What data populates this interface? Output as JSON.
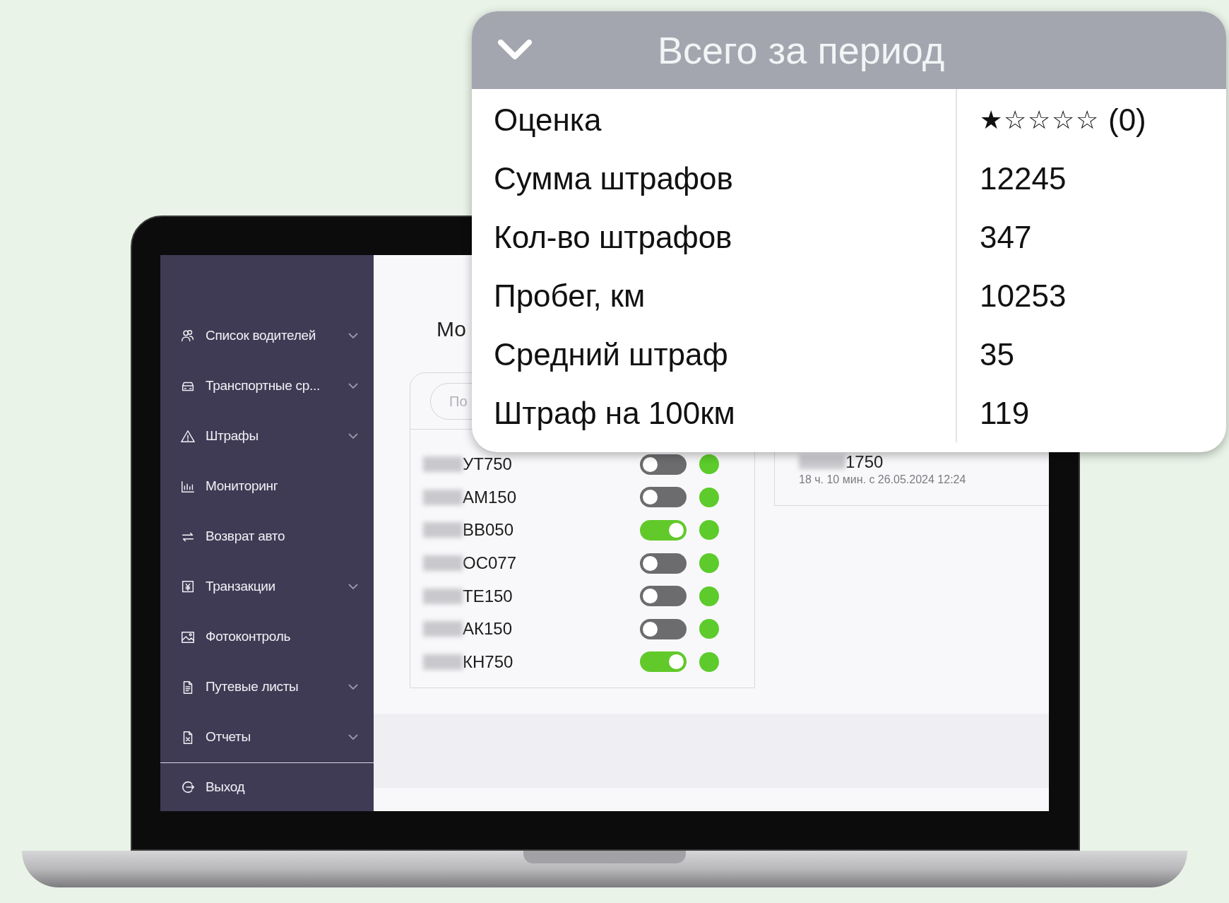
{
  "sidebar": {
    "items": [
      {
        "label": "Список водителей",
        "expandable": true
      },
      {
        "label": "Транспортные ср...",
        "expandable": true
      },
      {
        "label": "Штрафы",
        "expandable": true
      },
      {
        "label": "Мониторинг",
        "expandable": false
      },
      {
        "label": "Возврат авто",
        "expandable": false
      },
      {
        "label": "Транзакции",
        "expandable": true
      },
      {
        "label": "Фотоконтроль",
        "expandable": false
      },
      {
        "label": "Путевые листы",
        "expandable": true
      },
      {
        "label": "Отчеты",
        "expandable": true
      }
    ],
    "exit": {
      "label": "Выход"
    }
  },
  "page_title": "Мо",
  "search": {
    "placeholder": "По"
  },
  "vehicles": [
    {
      "plate": "УТ750",
      "on": false,
      "color": "#5ccb2b"
    },
    {
      "plate": "АМ150",
      "on": false,
      "color": "#5ccb2b"
    },
    {
      "plate": "ВВ050",
      "on": true,
      "color": "#5ccb2b"
    },
    {
      "plate": "ОС077",
      "on": false,
      "color": "#5ccb2b"
    },
    {
      "plate": "ТЕ150",
      "on": false,
      "color": "#5ccb2b"
    },
    {
      "plate": "АК150",
      "on": false,
      "color": "#5ccb2b"
    },
    {
      "plate": "КН750",
      "on": true,
      "color": "#5ccb2b"
    }
  ],
  "detail_card": {
    "plate": "1750",
    "duration": "18 ч. 10 мин. с 26.05.2024 12:24"
  },
  "summary_popup": {
    "title": "Всего за период",
    "expanded": true,
    "rows": [
      {
        "label": "Оценка",
        "kind": "rating",
        "stars": 1,
        "value": "(0)"
      },
      {
        "label": "Сумма штрафов",
        "kind": "text",
        "value": "12245"
      },
      {
        "label": "Кол-во штрафов",
        "kind": "text",
        "value": "347"
      },
      {
        "label": "Пробег, км",
        "kind": "text",
        "value": "10253"
      },
      {
        "label": "Средний штраф",
        "kind": "text",
        "value": "35"
      },
      {
        "label": "Штраф на 100км",
        "kind": "text",
        "value": "119"
      }
    ]
  }
}
